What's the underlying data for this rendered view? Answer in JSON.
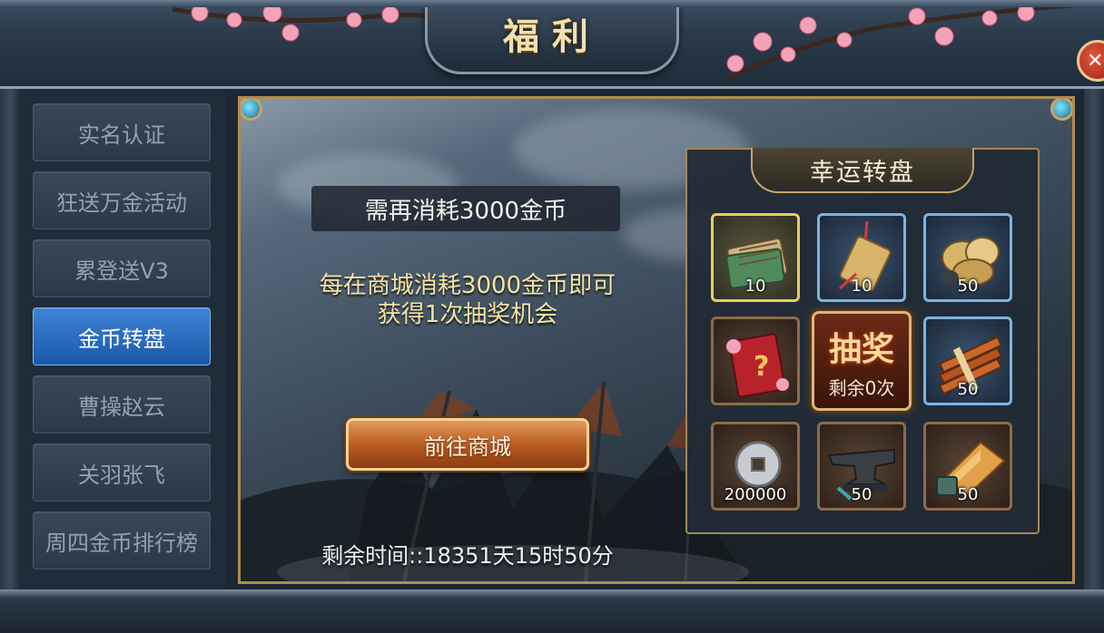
{
  "header": {
    "title": "福利",
    "close_icon": "close-icon"
  },
  "sidebar": {
    "items": [
      {
        "label": "实名认证",
        "active": false
      },
      {
        "label": "狂送万金活动",
        "active": false
      },
      {
        "label": "累登送V3",
        "active": false
      },
      {
        "label": "金币转盘",
        "active": true
      },
      {
        "label": "曹操赵云",
        "active": false
      },
      {
        "label": "关羽张飞",
        "active": false
      },
      {
        "label": "周四金币排行榜",
        "active": false
      }
    ]
  },
  "main": {
    "need_text": "需再消耗3000金币",
    "desc_line1": "每在商城消耗3000金币即可",
    "desc_line2": "获得1次抽奖机会",
    "shop_button": "前往商城",
    "remaining_time": "剩余时间::18351天15时50分"
  },
  "wheel": {
    "title": "幸运转盘",
    "draw_label": "抽奖",
    "draw_remaining": "剩余0次",
    "items": [
      {
        "icon": "scroll-book-icon",
        "qty": "10",
        "rarity": "gold"
      },
      {
        "icon": "talisman-icon",
        "qty": "10",
        "rarity": "blue"
      },
      {
        "icon": "ore-icon",
        "qty": "50",
        "rarity": "blue"
      },
      {
        "icon": "mystery-book-icon",
        "qty": "",
        "rarity": "brown"
      },
      {
        "icon": "bamboo-bundle-icon",
        "qty": "50",
        "rarity": "blue"
      },
      {
        "icon": "coin-icon",
        "qty": "200000",
        "rarity": "brown"
      },
      {
        "icon": "anvil-icon",
        "qty": "50",
        "rarity": "brown"
      },
      {
        "icon": "whetstone-icon",
        "qty": "50",
        "rarity": "brown"
      }
    ]
  },
  "colors": {
    "accent_gold": "#f6e3a2",
    "active_tab": "#2a6cc0",
    "frame_gold": "#b28b4f"
  }
}
